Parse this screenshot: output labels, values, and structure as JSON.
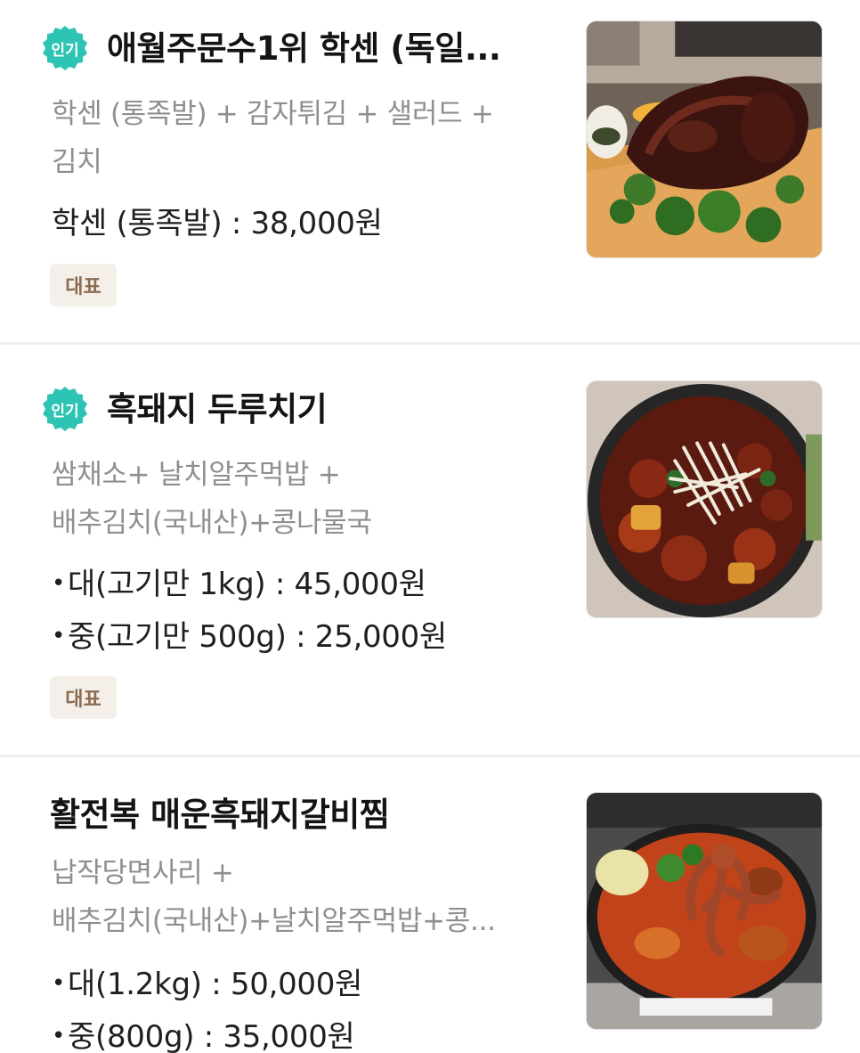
{
  "menu": {
    "popular_badge": "인기",
    "items": [
      {
        "name": "애월주문수1위 학센 (독일...",
        "popular": true,
        "description_lines": [
          "학센 (통족발) + 감자튀김 + 샐러드 +",
          "김치"
        ],
        "prices": [
          "학센 (통족발) : 38,000원"
        ],
        "tag": "대표",
        "image_icon": "pork-knuckle-photo"
      },
      {
        "name": "흑돼지 두루치기",
        "popular": true,
        "description_lines": [
          "쌈채소+ 날치알주먹밥 +",
          "배추김치(국내산)+콩나물국"
        ],
        "prices": [
          "대(고기만 1kg) : 45,000원",
          "중(고기만 500g) : 25,000원"
        ],
        "tag": "대표",
        "image_icon": "stir-fried-pork-photo"
      },
      {
        "name": "활전복 매운흑돼지갈비찜",
        "popular": false,
        "description_lines": [
          "납작당면사리 +",
          "배추김치(국내산)+날치알주먹밥+콩..."
        ],
        "prices": [
          "대(1.2kg) : 50,000원",
          "중(800g) : 35,000원"
        ],
        "image_icon": "braised-ribs-octopus-photo"
      }
    ]
  },
  "colors": {
    "badge_teal": "#2ec4b3",
    "tag_bg": "#f4efe9",
    "tag_text": "#8b6b50",
    "desc_gray": "#8f8f8f"
  }
}
